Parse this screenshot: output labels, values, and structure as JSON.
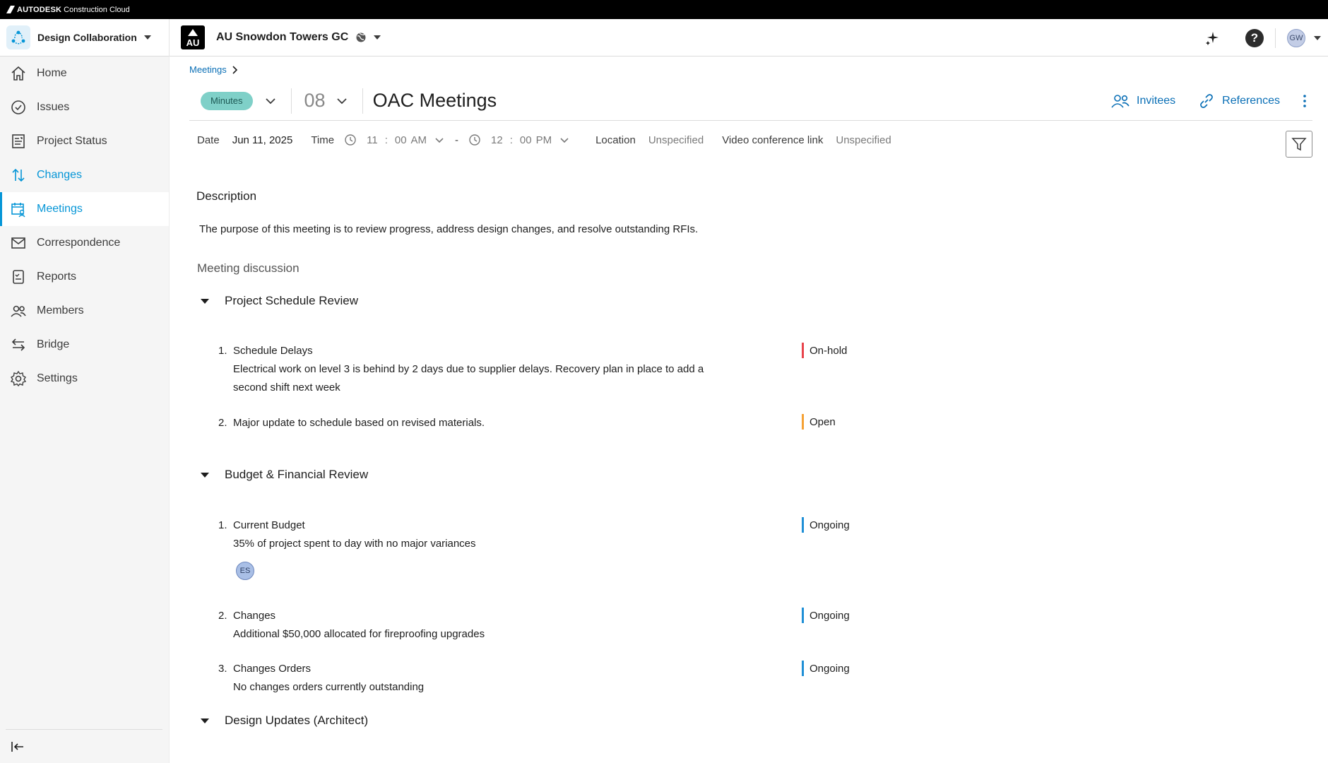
{
  "brand": {
    "name": "AUTODESK",
    "product_line": "Construction Cloud"
  },
  "header": {
    "product": "Design Collaboration",
    "project": "AU Snowdon Towers GC",
    "project_logo": "AU",
    "avatar": "GW",
    "help": "?"
  },
  "sidebar": {
    "items": [
      {
        "label": "Home",
        "icon": "home-icon"
      },
      {
        "label": "Issues",
        "icon": "check-circle-icon"
      },
      {
        "label": "Project Status",
        "icon": "report-icon"
      },
      {
        "label": "Changes",
        "icon": "arrows-icon"
      },
      {
        "label": "Meetings",
        "icon": "calendar-people-icon"
      },
      {
        "label": "Correspondence",
        "icon": "mail-icon"
      },
      {
        "label": "Reports",
        "icon": "clipboard-icon"
      },
      {
        "label": "Members",
        "icon": "people-icon"
      },
      {
        "label": "Bridge",
        "icon": "bridge-icon"
      },
      {
        "label": "Settings",
        "icon": "gear-icon"
      }
    ]
  },
  "breadcrumb": {
    "label": "Meetings"
  },
  "meeting": {
    "status_pill": "Minutes",
    "number": "08",
    "title": "OAC Meetings",
    "invitees_label": "Invitees",
    "references_label": "References"
  },
  "meta": {
    "date_label": "Date",
    "date": "Jun 11, 2025",
    "time_label": "Time",
    "start_hour": "11",
    "start_min": "00",
    "start_ampm": "AM",
    "dash": "-",
    "end_hour": "12",
    "end_min": "00",
    "end_ampm": "PM",
    "location_label": "Location",
    "location": "Unspecified",
    "video_label": "Video conference link",
    "video": "Unspecified"
  },
  "description": {
    "heading": "Description",
    "text": "The purpose of this meeting is to review progress, address design changes, and resolve outstanding RFIs."
  },
  "discussion": {
    "heading": "Meeting discussion",
    "groups": [
      {
        "title": "Project Schedule Review",
        "items": [
          {
            "num": "1.",
            "title": "Schedule Delays",
            "detail1": "Electrical work on level 3 is behind by 2 days due to supplier delays. Recovery plan in place to add a",
            "detail2": "second shift next week",
            "status": "On-hold"
          },
          {
            "num": "2.",
            "title": "Major update to schedule based on revised materials.",
            "status": "Open"
          }
        ]
      },
      {
        "title": "Budget & Financial Review",
        "items": [
          {
            "num": "1.",
            "title": "Current Budget",
            "detail1": "35% of project spent to day with no major variances",
            "assignee": "ES",
            "status": "Ongoing"
          },
          {
            "num": "2.",
            "title": "Changes",
            "detail1": "Additional $50,000 allocated for fireproofing upgrades",
            "status": "Ongoing"
          },
          {
            "num": "3.",
            "title": "Changes Orders",
            "detail1": "No changes orders currently outstanding",
            "status": "Ongoing"
          }
        ]
      },
      {
        "title": "Design Updates (Architect)"
      }
    ]
  },
  "colors": {
    "accent": "#0696d7",
    "on_hold": "#e8434b",
    "open": "#f5a134",
    "ongoing": "#1f8fd6",
    "pill": "#7fd0c8"
  }
}
